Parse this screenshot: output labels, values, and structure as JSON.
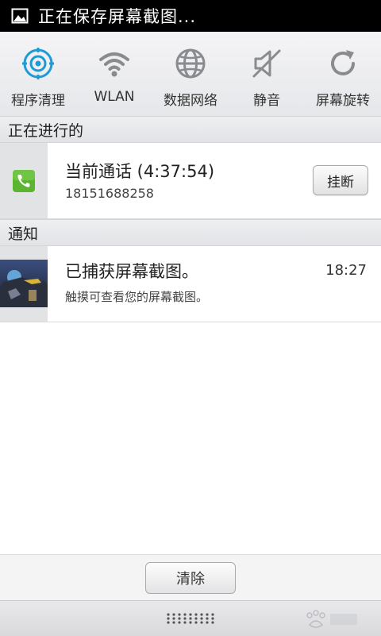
{
  "status_bar": {
    "title": "正在保存屏幕截图..."
  },
  "quick_toggles": [
    {
      "label": "程序清理",
      "icon": "cleanup-icon",
      "active": true
    },
    {
      "label": "WLAN",
      "icon": "wifi-icon",
      "active": false
    },
    {
      "label": "数据网络",
      "icon": "globe-icon",
      "active": false
    },
    {
      "label": "静音",
      "icon": "mute-icon",
      "active": false
    },
    {
      "label": "屏幕旋转",
      "icon": "rotate-icon",
      "active": false
    }
  ],
  "ongoing": {
    "header": "正在进行的",
    "call": {
      "title": "当前通话 (4:37:54)",
      "number": "18151688258",
      "hangup_label": "挂断",
      "icon": "phone-icon"
    }
  },
  "notifications": {
    "header": "通知",
    "items": [
      {
        "title": "已捕获屏幕截图。",
        "subtitle": "触摸可查看您的屏幕截图。",
        "time": "18:27",
        "icon": "screenshot-thumbnail"
      }
    ]
  },
  "footer": {
    "clear_label": "清除"
  },
  "colors": {
    "accent": "#1e9ad6",
    "phone_green": "#5cb531",
    "status_bar": "#000000"
  }
}
